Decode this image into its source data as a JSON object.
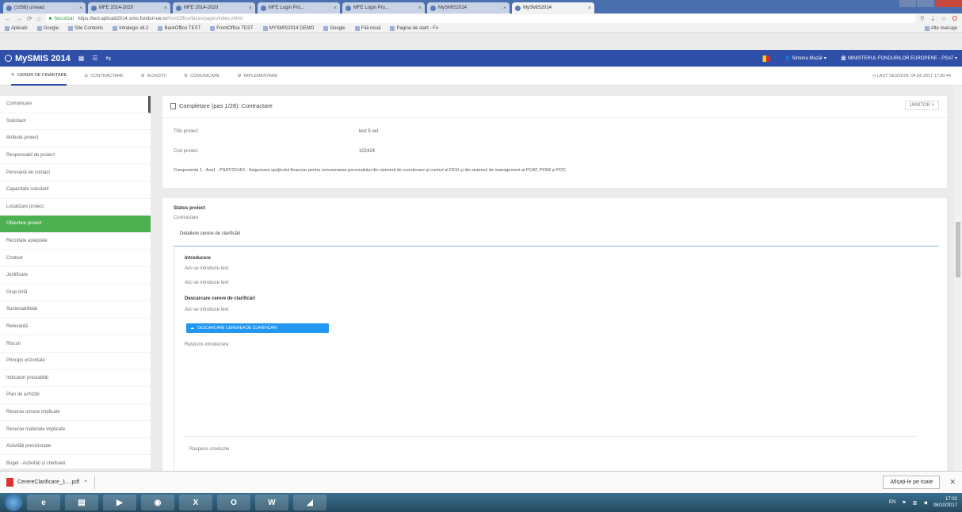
{
  "browser": {
    "tabs": [
      {
        "label": "(1058) unread"
      },
      {
        "label": "MFE 2014-2020"
      },
      {
        "label": "MFE 2014-2020"
      },
      {
        "label": "MFE Login Pro..."
      },
      {
        "label": "MFE Login Pro..."
      },
      {
        "label": "MySMIS2014"
      },
      {
        "label": "MySMIS2014",
        "active": true
      }
    ],
    "secure_label": "Securizat",
    "url_base": "https://test.aplicatii2014.smis.fonduri-ue.ro",
    "url_path": "/frontOffice/faces/pages/index.xhtml",
    "bookmarks": [
      "Aplicatii",
      "Google",
      "Site Contents",
      "Intralegis v6.2",
      "BackOffice TEST",
      "FrontOffice TEST",
      "MYSMIS2014 DEMO",
      "Google",
      "Filă nouă",
      "Pagina de start - Fo"
    ],
    "bookmarks_more": "Alte marcaje"
  },
  "app": {
    "logo": "MySMIS 2014",
    "user": "Simona Mazăr",
    "org": "MINISTERUL FONDURILOR EUROPENE - PSAT",
    "nav": [
      {
        "label": "Cereri de finanțare",
        "active": true
      },
      {
        "label": "Contractare"
      },
      {
        "label": "Achiziții"
      },
      {
        "label": "Comunicare"
      },
      {
        "label": "Implementare"
      }
    ],
    "timestamp": "Last session: 04.08.2017 17:00:44"
  },
  "sidebar": {
    "items": [
      "Comunicare",
      "Solicitant",
      "Atribute proiect",
      "Responsabil de proiect",
      "Persoană de contact",
      "Capacitate solicitant",
      "Localizare proiect",
      "Obiective proiect",
      "Rezultate așteptate",
      "Context",
      "Justificare",
      "Grup țintă",
      "Sustenabilitate",
      "Relevanță",
      "Riscuri",
      "Principii orizontale",
      "Indicatori prestabiliți",
      "Plan de achiziții",
      "Resurse umane implicate",
      "Resurse materiale implicate",
      "Activități previzionate",
      "Buget - Activități și cheltuieli"
    ],
    "active_index": 7
  },
  "card1": {
    "title": "Completare (pas 1/28): Contractare",
    "header_button": "URMTOR >",
    "fields": [
      {
        "label": "Titlu proiect",
        "value": "test 5 oct"
      },
      {
        "label": "Cod proiect",
        "value": "102424"
      }
    ],
    "description": "Componenta 1 - Axa1 - PSAT/2014/1 - Asigurarea sprijinului financiar pentru remunerarea personalului din sistemul de coordonare și control al FESI și din sistemul de management al POAT, POIM și POC"
  },
  "card2": {
    "status_label": "Status proiect",
    "status_value": "Contractare",
    "details_label": "Detaliere cerere de clarificări",
    "intro_title": "Introducere",
    "intro_line1": "Aici se introduce text",
    "intro_line2": "Aici se introduce text",
    "download_title": "Descarcare cerere de clarificări",
    "download_line": "Aici se introduce text",
    "download_button": "Descarcare cererea de clarificari",
    "response_intro": "Raspuns introducere",
    "response_final": "Raspuns concluzie"
  },
  "downloads": {
    "file": "CerereClarificare_1....pdf",
    "show_all": "Afișați-le pe toate"
  },
  "taskbar": {
    "lang": "EN",
    "time": "17:02",
    "date": "06/10/2017"
  }
}
